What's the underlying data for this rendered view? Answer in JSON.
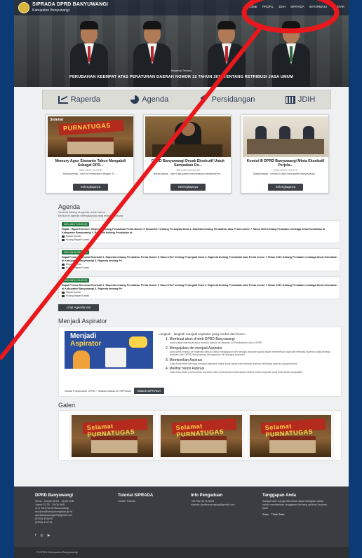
{
  "site": {
    "title": "SIPRADA DPRD BANYUWANGI",
    "subtitle": "Kabupaten Banyuwangi",
    "nav": [
      "HOME",
      "PROFIL",
      "JDIH",
      "SIPRADA",
      "INFORMASI",
      "KONTAK"
    ]
  },
  "hero": {
    "caption_small": "Raperda Terbaru",
    "caption": "PERUBAHAN KEEMPAT ATAS PERATURAN DAERAH NOMOR 12 TAHUN 2011 TENTANG RETRIBUSI JASA UMUM"
  },
  "menu": [
    {
      "label": "Raperda",
      "icon": "chart-icon"
    },
    {
      "label": "Agenda",
      "icon": "pie-icon"
    },
    {
      "label": "Persidangan",
      "icon": "gavel-icon"
    },
    {
      "label": "JDIH",
      "icon": "bar-chart-icon"
    }
  ],
  "news": [
    {
      "title": "Memory Agus Siswanto Tahun Mengabdi Sebagai DPR...",
      "date": "2021-08-27 11:00:00",
      "excerpt": "Banyuwangi - hari ini bertepatan dengan 31 ...",
      "button": "Selengkapnya"
    },
    {
      "title": "DPRD Banyuwangi Desak Eksekutif Untuk Sampaikan Do...",
      "date": "2021-08-23 13:00:00",
      "excerpt": "Banyuwangi - dprd kabupaten banyuwangi mendesak ek...",
      "button": "Selengkapnya"
    },
    {
      "title": "Komisi III DPRD Banyuwangi Minta Eksekutif Perjela...",
      "date": "2021-08-23 13:10:13",
      "excerpt": "Banyuwangi - komisi iii dprd kabupaten banyuwangi ...",
      "button": "Selengkapnya"
    }
  ],
  "agenda": {
    "title": "Agenda",
    "intro_1": "Selamat datang di agenda untuk hari ini.",
    "intro_2": "Berikut ini agenda selengkapnya yang telah terlaksana.",
    "items": [
      {
        "date": "2021-08-27 09:00:00",
        "text": "Rapat - Rapat Fomus 1. Raperda tentang Perubahan Perda Nomor 5 Tahun2017 tentang Perangkat Desa 2. Raperda tentang Perubahan atas Perda nomor 7 Tahun 2010 tentang Penataan Lembaga Desa/ Kelurahan di Kabupaten Banyuwangi 3. Raperda tentang Perubahan at",
        "room_1": "Rapat Komisi",
        "room_2": "Ruang Rapat Komisi"
      },
      {
        "date": "2021-08-30 09:00:00",
        "text": "Rapat Fomus Bersama Eksekutif 1. Raperda tentang Perubahan Perda Nomor 5 Tahun 2017 tentang Perangkat Desa 2. Raperda tentang Perubahan atas Perda nomor 7 Tahun 2010 tentang Penataan Lembaga Desa/ Kelurahan di Kabupaten Banyuwangi 3. Raperda tentang Pe",
        "room_1": "Rapat Fomus",
        "room_2": "Ruang Rapat Komisi"
      },
      {
        "date": "2021-08-31 09:00:00",
        "text": "Rapat Fomus Bersama Eksekutif 1. Raperda tentang Perubahan Perda Nomor 5 Tahun 2017 tentang Perangkat Desa 2. Raperda tentang Perubahan atas Perda nomor 7 Tahun 2010 tentang Penataan Lembaga Desa/ Kelurahan di Kabupaten Banyuwangi 3. Raperda tentang Pe",
        "room_1": "Rapat Komisi",
        "room_2": "Ruang Rapat Komisi"
      }
    ],
    "more_button": "Lihat Agenda lain"
  },
  "aspirator": {
    "title": "Menjadi Aspirator",
    "poster_line_1": "Menjadi",
    "poster_line_2": "Aspirator",
    "lead": "Langkah - langkah menjadi Aspirator yang cerdas dan keren:",
    "steps": [
      {
        "title": "1. Membuat akun di web DPRD Banyuwangi",
        "desc": "Anda dapat membuat akun terlebih dahulu di halaman ini Pendaftaran Akun DPRD"
      },
      {
        "title": "2. Mengajukan diri menjadi Aspirator",
        "desc": "Anda perlu masuk ke halaman dahulu untuk mengajukan diri sebagai aspirator guna dapat memberikan aspirasi terhadap raperda yang sedang dibahas oleh DPRD Banyuwangi Mengajukan diri sebagai Aspirator"
      },
      {
        "title": "3. Memberikan Aspirasi",
        "desc": "Saat Anda telah berhasil menjadi aspirator maka Anda dapat memberikan aspirasi terhadap raperda yang tersedia"
      },
      {
        "title": "4. Melihat histori Aspirasi",
        "desc": "Saat Anda telah memberikan aspirasi maka selanjutnya Anda dapat melihat histori aspirasi yang telah Anda sampaikan"
      }
    ],
    "question": "Sudah Punya akun DPRD ? silakan masuk ke SIPRADA",
    "login_button": "Masuk SIPRADA"
  },
  "gallery": {
    "title": "Galeri",
    "items": [
      "Selamat PURNATUGAS",
      "Selamat PURNATUGAS",
      "Selamat PURNATUGAS"
    ]
  },
  "footer": {
    "col1": {
      "title": "DPRD Banyuwangi",
      "lines": [
        "Senin - Kamis 08:00 - 16:00 WIB",
        "Jumat 07:30 - 16:00 WIB",
        "",
        "Jl. A Yani No.99 Banyuwangi",
        "set.dprd@banyuwangikab.go.id",
        "dprdbanyuwangi19@gmail.com",
        "(0333) 424465",
        "(0333) 411716"
      ]
    },
    "col2": {
      "title": "Tutorial SIPRADA",
      "lines": [
        "Unduh Tutorial"
      ]
    },
    "col3": {
      "title": "Info Pengaduan",
      "lines": [
        "+62 852-3174-6026",
        "siprada.dprdbanyuwangi@gmail.com"
      ]
    },
    "col4": {
      "title": "Tanggapan Anda",
      "lines": [
        "Sangat kami hargai bila Anda dapat luangkan waktu untuk memberikan tanggapan tentang aplikasi Aspirasi kami"
      ],
      "like": "Suka",
      "dislike": "Tidak Suka"
    },
    "social": [
      "f",
      "◎",
      "▶"
    ],
    "copyright": "© DPRD Kabupaten Banyuwangi"
  },
  "colors": {
    "annotation": "#e8181c",
    "agenda_badge": "#1f7a3a",
    "page_border": "#0b3a75"
  }
}
